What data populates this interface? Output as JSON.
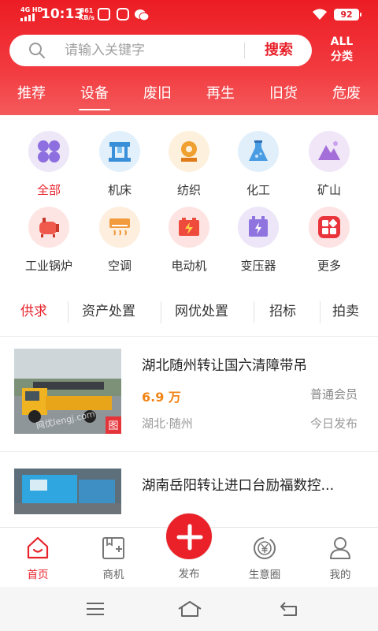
{
  "status_bar": {
    "network": "4G HD",
    "time": "10:13",
    "speed_value": "361",
    "speed_unit": "KB/s",
    "battery": "92"
  },
  "search": {
    "placeholder": "请输入关键字",
    "button": "搜索"
  },
  "all_categories": {
    "line1": "ALL",
    "line2": "分类"
  },
  "tabs": [
    {
      "label": "推荐"
    },
    {
      "label": "设备"
    },
    {
      "label": "废旧"
    },
    {
      "label": "再生"
    },
    {
      "label": "旧货"
    },
    {
      "label": "危废"
    }
  ],
  "categories": [
    {
      "label": "全部",
      "icon": "grid-icon"
    },
    {
      "label": "机床",
      "icon": "machine-tool-icon"
    },
    {
      "label": "纺织",
      "icon": "textile-icon"
    },
    {
      "label": "化工",
      "icon": "flask-icon"
    },
    {
      "label": "矿山",
      "icon": "mountain-icon"
    },
    {
      "label": "工业锅炉",
      "icon": "boiler-icon"
    },
    {
      "label": "空调",
      "icon": "air-conditioner-icon"
    },
    {
      "label": "电动机",
      "icon": "battery-icon"
    },
    {
      "label": "变压器",
      "icon": "transformer-icon"
    },
    {
      "label": "更多",
      "icon": "more-icon"
    }
  ],
  "filters": [
    {
      "label": "供求"
    },
    {
      "label": "资产处置"
    },
    {
      "label": "网优处置"
    },
    {
      "label": "招标"
    },
    {
      "label": "拍卖"
    }
  ],
  "listings": [
    {
      "title": "湖北随州转让国六清障带吊",
      "price": "6.9 万",
      "member": "普通会员",
      "location": "湖北·随州",
      "posted": "今日发布",
      "image_badge": "图",
      "watermark": "网优lengj.com"
    },
    {
      "title": "湖南岳阳转让进口台励福数控..."
    }
  ],
  "bottom_nav": [
    {
      "label": "首页",
      "icon": "home-icon"
    },
    {
      "label": "商机",
      "icon": "business-icon"
    },
    {
      "label": "发布",
      "icon": "plus-icon"
    },
    {
      "label": "生意圈",
      "icon": "coin-icon"
    },
    {
      "label": "我的",
      "icon": "user-icon"
    }
  ],
  "colors": {
    "brand_red": "#e8212a",
    "price_orange": "#f08516"
  }
}
